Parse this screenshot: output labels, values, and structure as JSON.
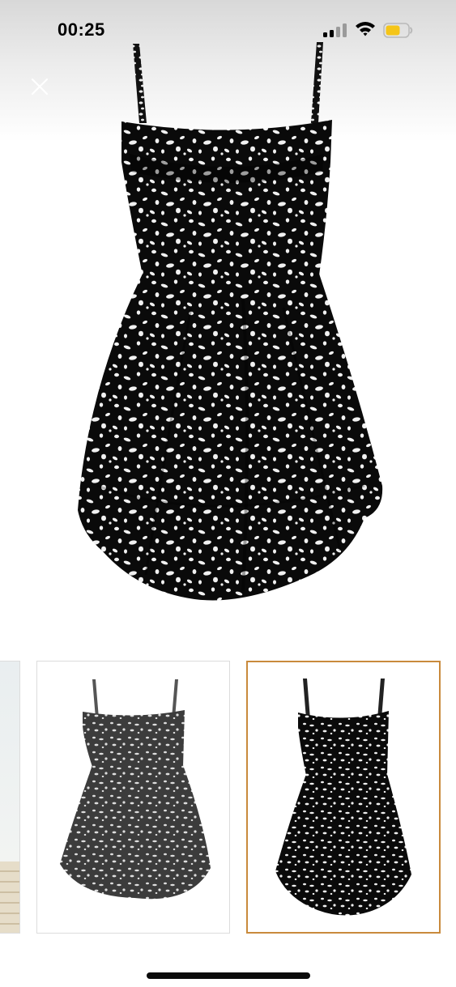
{
  "status_bar": {
    "time": "00:25",
    "signal_icon": "cellular-signal-icon",
    "wifi_icon": "wifi-icon",
    "battery_icon": "battery-icon",
    "battery_color": "#f5c518"
  },
  "viewer": {
    "close_icon": "close-icon",
    "main_image": "black-white-print-cami-dress",
    "accent_color": "#c98a3c"
  },
  "thumbnails": [
    {
      "image": "room-scene-partial",
      "selected": false
    },
    {
      "image": "grey-print-cami-dress",
      "selected": false
    },
    {
      "image": "black-print-cami-dress",
      "selected": true
    }
  ]
}
